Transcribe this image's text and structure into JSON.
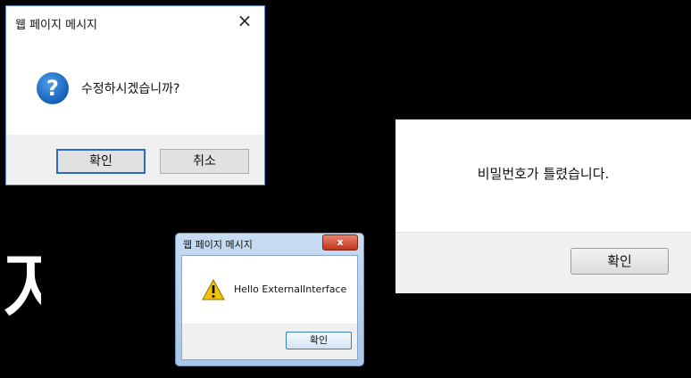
{
  "background": {
    "partial_glyph": "지"
  },
  "dialog_confirm": {
    "title": "웹 페이지 메시지",
    "close_icon": "×",
    "question_icon": "?",
    "message": "수정하시겠습니까?",
    "ok_label": "확인",
    "cancel_label": "취소",
    "accent_color": "#2b68c7"
  },
  "dialog_password": {
    "message": "비밀번호가 틀렸습니다.",
    "ok_label": "확인"
  },
  "dialog_alert": {
    "title": "웹 페이지 메시지",
    "close_icon": "x",
    "message": "Hello ExternalInterface",
    "ok_label": "확인",
    "icon": "warning-icon"
  }
}
